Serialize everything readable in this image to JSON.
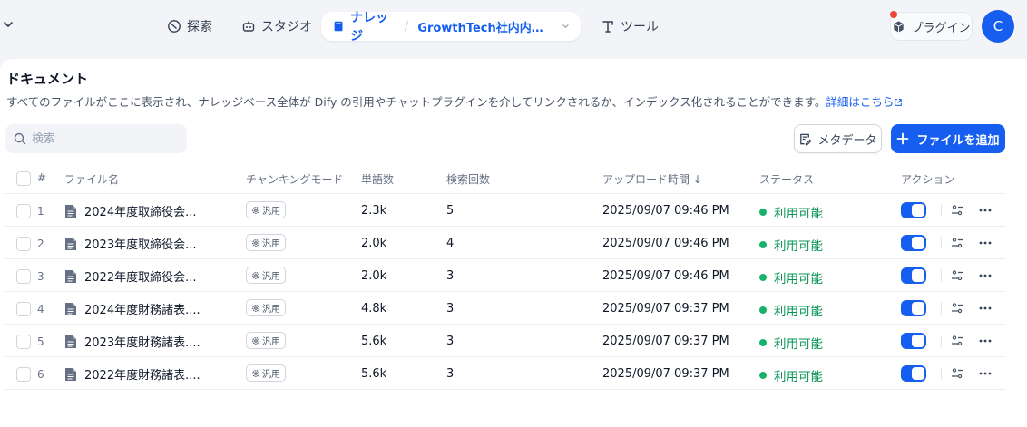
{
  "nav": {
    "explore": "探索",
    "studio": "スタジオ",
    "knowledge": "ナレッジ",
    "dataset_name": "GrowthTech社内内部情...",
    "tools": "ツール",
    "plugins": "プラグイン",
    "avatar_initial": "C"
  },
  "page": {
    "title": "ドキュメント",
    "description": "すべてのファイルがここに表示され、ナレッジベース全体が Dify の引用やチャットプラグインを介してリンクされるか、インデックス化されることができます。",
    "details_link": "詳細はこちら"
  },
  "toolbar": {
    "search_placeholder": "検索",
    "metadata_label": "メタデータ",
    "add_file_label": "ファイルを追加"
  },
  "table": {
    "headers": {
      "num": "#",
      "name": "ファイル名",
      "mode": "チャンキングモード",
      "words": "単語数",
      "hits": "検索回数",
      "uploaded": "アップロード時間 ↓",
      "status": "ステータス",
      "action": "アクション"
    },
    "rows": [
      {
        "num": "1",
        "name": "2024年度取締役会...",
        "mode": "汎用",
        "words": "2.3k",
        "hits": "5",
        "uploaded": "2025/09/07 09:46 PM",
        "status": "利用可能",
        "enabled": true
      },
      {
        "num": "2",
        "name": "2023年度取締役会...",
        "mode": "汎用",
        "words": "2.0k",
        "hits": "4",
        "uploaded": "2025/09/07 09:46 PM",
        "status": "利用可能",
        "enabled": true
      },
      {
        "num": "3",
        "name": "2022年度取締役会...",
        "mode": "汎用",
        "words": "2.0k",
        "hits": "3",
        "uploaded": "2025/09/07 09:46 PM",
        "status": "利用可能",
        "enabled": true
      },
      {
        "num": "4",
        "name": "2024年度財務諸表....",
        "mode": "汎用",
        "words": "4.8k",
        "hits": "3",
        "uploaded": "2025/09/07 09:37 PM",
        "status": "利用可能",
        "enabled": true
      },
      {
        "num": "5",
        "name": "2023年度財務諸表....",
        "mode": "汎用",
        "words": "5.6k",
        "hits": "3",
        "uploaded": "2025/09/07 09:37 PM",
        "status": "利用可能",
        "enabled": true
      },
      {
        "num": "6",
        "name": "2022年度財務諸表....",
        "mode": "汎用",
        "words": "5.6k",
        "hits": "3",
        "uploaded": "2025/09/07 09:37 PM",
        "status": "利用可能",
        "enabled": true
      }
    ]
  },
  "colors": {
    "accent": "#155eef",
    "status_green": "#17b26a"
  }
}
